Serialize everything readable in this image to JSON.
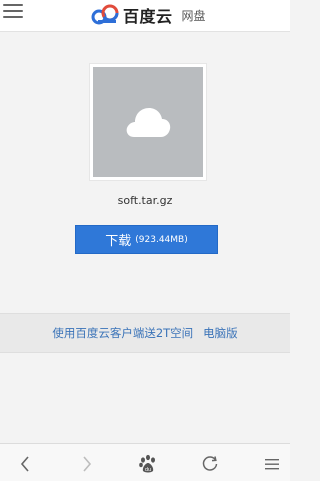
{
  "header": {
    "brand_name": "百度云",
    "brand_sub": "网盘"
  },
  "file": {
    "name": "soft.tar.gz",
    "download_label": "下载",
    "size": "(923.44MB)"
  },
  "banner": {
    "client_link": "使用百度云客户端送2T空间",
    "pc_link": "电脑版"
  },
  "toolbar": {
    "icons": [
      "back-icon",
      "forward-icon",
      "paw-icon",
      "refresh-icon",
      "menu-icon"
    ]
  },
  "colors": {
    "accent": "#2f78d8",
    "link": "#3a73b8",
    "brand_blue": "#2e6fd8"
  }
}
